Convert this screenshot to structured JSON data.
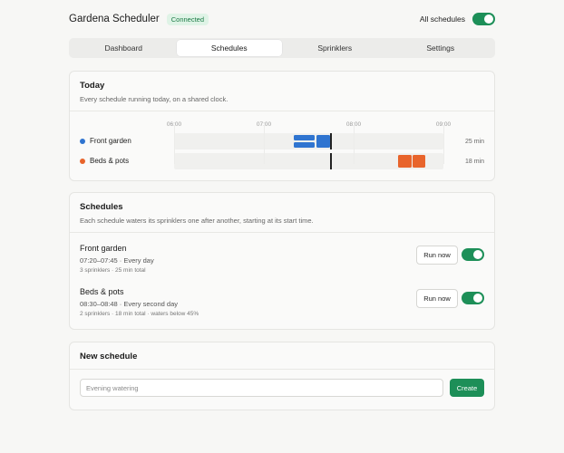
{
  "app": {
    "title": "Gardena Scheduler",
    "connection_status": "Connected",
    "all_schedules_label": "All schedules",
    "all_schedules_on": true
  },
  "tabs": [
    {
      "label": "Dashboard",
      "active": false
    },
    {
      "label": "Schedules",
      "active": true
    },
    {
      "label": "Sprinklers",
      "active": false
    },
    {
      "label": "Settings",
      "active": false
    }
  ],
  "today": {
    "title": "Today",
    "subtitle": "Every schedule running today, on a shared clock.",
    "ticks": [
      "06:00",
      "07:00",
      "08:00",
      "09:00"
    ],
    "rows": [
      {
        "label": "Front garden",
        "color": "#2f74d0",
        "duration": "25 min"
      },
      {
        "label": "Beds & pots",
        "color": "#e8642b",
        "duration": "18 min"
      }
    ]
  },
  "schedules": {
    "title": "Schedules",
    "subtitle": "Each schedule waters its sprinklers one after another, starting at its start time.",
    "items": [
      {
        "name": "Front garden",
        "time": "07:20–07:45 · Every day",
        "meta": "3 sprinklers · 25 min total",
        "run_label": "Run now",
        "enabled": true
      },
      {
        "name": "Beds & pots",
        "time": "08:30–08:48 · Every second day",
        "meta": "2 sprinklers · 18 min total · waters below 45%",
        "run_label": "Run now",
        "enabled": true
      }
    ]
  },
  "new_schedule": {
    "title": "New schedule",
    "placeholder": "Evening watering",
    "value": "",
    "create_label": "Create"
  },
  "colors": {
    "accent": "#1d8f58",
    "front_garden": "#2f74d0",
    "beds_pots": "#e8642b",
    "now_line": "#222222"
  }
}
